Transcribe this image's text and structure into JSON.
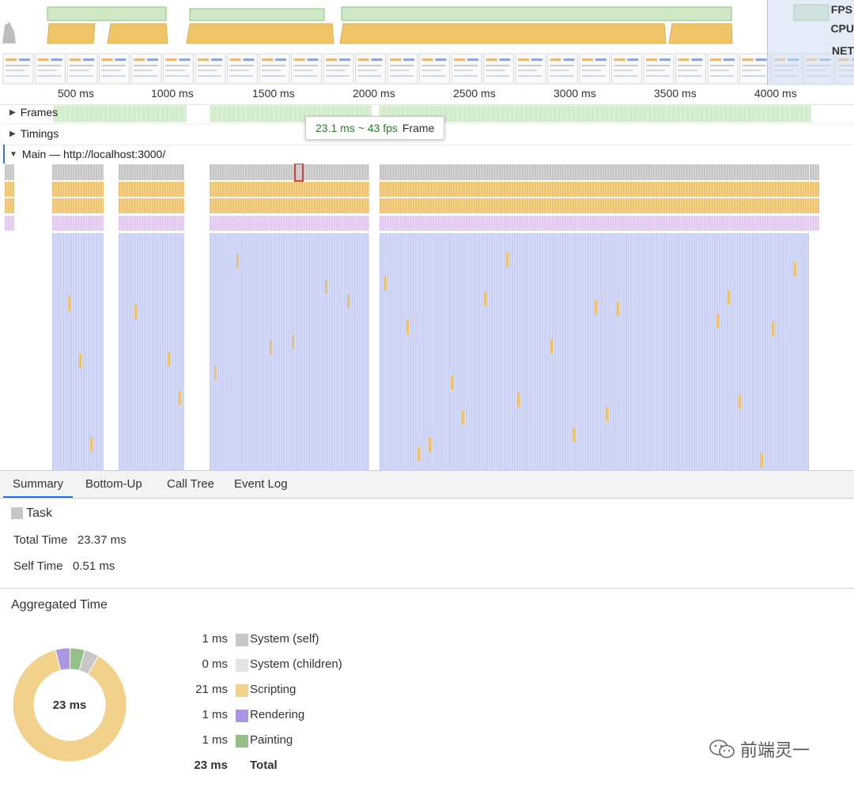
{
  "overview": {
    "labels": [
      "FPS",
      "CPU",
      "NET"
    ]
  },
  "ruler": {
    "ticks": [
      "500 ms",
      "1000 ms",
      "1500 ms",
      "2000 ms",
      "2500 ms",
      "3000 ms",
      "3500 ms",
      "4000 ms"
    ]
  },
  "tracks": {
    "frames": "Frames",
    "timings": "Timings",
    "main": "Main — http://localhost:3000/"
  },
  "tooltip": {
    "duration": "23.1 ms ~ 43 fps",
    "label": "Frame"
  },
  "tabs": [
    "Summary",
    "Bottom-Up",
    "Call Tree",
    "Event Log"
  ],
  "summary": {
    "task_name": "Task",
    "total_time_label": "Total Time",
    "total_time_value": "23.37 ms",
    "self_time_label": "Self Time",
    "self_time_value": "0.51 ms",
    "aggregated_title": "Aggregated Time",
    "donut_center": "23 ms",
    "legend": [
      {
        "value": "1 ms",
        "name": "System (self)",
        "color": "#c7c7c7"
      },
      {
        "value": "0 ms",
        "name": "System (children)",
        "color": "#e3e3e3"
      },
      {
        "value": "21 ms",
        "name": "Scripting",
        "color": "#f2d18a"
      },
      {
        "value": "1 ms",
        "name": "Rendering",
        "color": "#ab96e6"
      },
      {
        "value": "1 ms",
        "name": "Painting",
        "color": "#96c08a"
      }
    ],
    "total_value": "23 ms",
    "total_label": "Total"
  },
  "chart_data": {
    "type": "pie",
    "title": "Aggregated Time",
    "categories": [
      "System (self)",
      "System (children)",
      "Scripting",
      "Rendering",
      "Painting"
    ],
    "values": [
      1,
      0,
      21,
      1,
      1
    ],
    "colors": [
      "#c7c7c7",
      "#e3e3e3",
      "#f2d18a",
      "#ab96e6",
      "#96c08a"
    ]
  },
  "watermark": "前端灵一"
}
